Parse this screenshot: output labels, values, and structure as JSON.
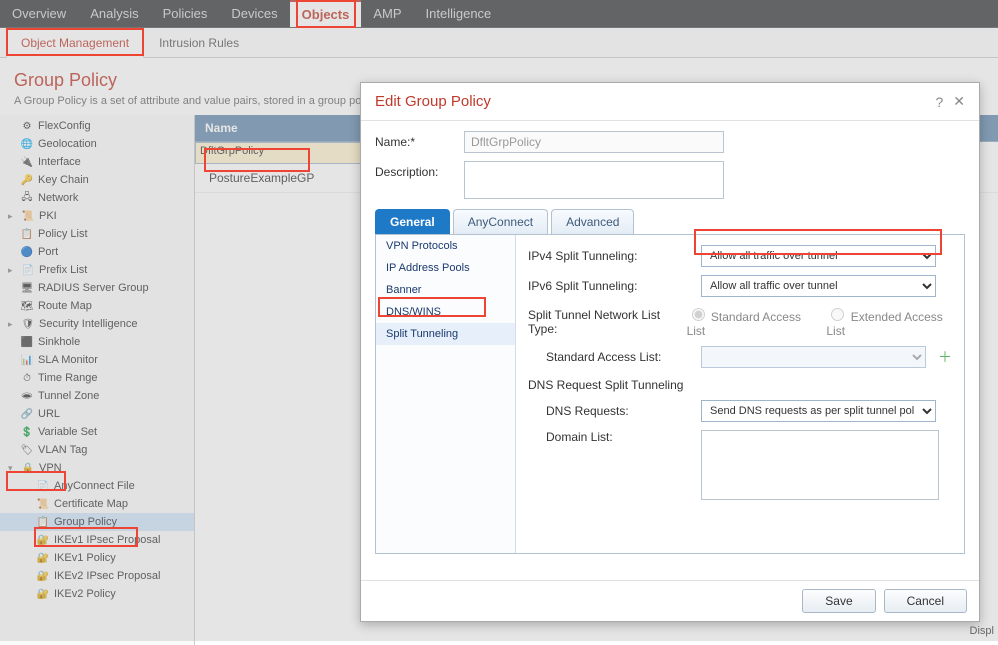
{
  "topnav": {
    "tabs": [
      "Overview",
      "Analysis",
      "Policies",
      "Devices",
      "Objects",
      "AMP",
      "Intelligence"
    ],
    "active": "Objects"
  },
  "subnav": {
    "tabs": [
      "Object Management",
      "Intrusion Rules"
    ],
    "active": "Object Management"
  },
  "page": {
    "title": "Group Policy",
    "desc": "A Group Policy is a set of attribute and value pairs, stored in a group policy object, that define the remote access VPN experience. The RADIUS authorization server assigns the group policy or"
  },
  "tree": [
    {
      "label": "FlexConfig",
      "icon": "⚙"
    },
    {
      "label": "Geolocation",
      "icon": "🌐"
    },
    {
      "label": "Interface",
      "icon": "🔌"
    },
    {
      "label": "Key Chain",
      "icon": "🔑"
    },
    {
      "label": "Network",
      "icon": "🖧"
    },
    {
      "label": "PKI",
      "icon": "📜",
      "caret": true
    },
    {
      "label": "Policy List",
      "icon": "📋"
    },
    {
      "label": "Port",
      "icon": "🔵"
    },
    {
      "label": "Prefix List",
      "icon": "📄",
      "caret": true
    },
    {
      "label": "RADIUS Server Group",
      "icon": "🖥"
    },
    {
      "label": "Route Map",
      "icon": "🗺"
    },
    {
      "label": "Security Intelligence",
      "icon": "🛡",
      "caret": true
    },
    {
      "label": "Sinkhole",
      "icon": "⬛"
    },
    {
      "label": "SLA Monitor",
      "icon": "📊"
    },
    {
      "label": "Time Range",
      "icon": "⏱"
    },
    {
      "label": "Tunnel Zone",
      "icon": "🕳"
    },
    {
      "label": "URL",
      "icon": "🔗"
    },
    {
      "label": "Variable Set",
      "icon": "💲"
    },
    {
      "label": "VLAN Tag",
      "icon": "🏷"
    },
    {
      "label": "VPN",
      "icon": "🔒",
      "caret": true,
      "open": true,
      "children": [
        {
          "label": "AnyConnect File",
          "icon": "📄"
        },
        {
          "label": "Certificate Map",
          "icon": "📜"
        },
        {
          "label": "Group Policy",
          "icon": "📋",
          "selected": true
        },
        {
          "label": "IKEv1 IPsec Proposal",
          "icon": "🔐"
        },
        {
          "label": "IKEv1 Policy",
          "icon": "🔐"
        },
        {
          "label": "IKEv2 IPsec Proposal",
          "icon": "🔐"
        },
        {
          "label": "IKEv2 Policy",
          "icon": "🔐"
        }
      ]
    }
  ],
  "list": {
    "header": "Name",
    "rows": [
      {
        "name": "DfltGrpPolicy",
        "selected": true
      },
      {
        "name": "PostureExampleGP"
      }
    ]
  },
  "modal": {
    "title": "Edit Group Policy",
    "name_label": "Name:*",
    "name_value": "DfltGrpPolicy",
    "desc_label": "Description:",
    "tabs": [
      "General",
      "AnyConnect",
      "Advanced"
    ],
    "active_tab": "General",
    "side_items": [
      "VPN Protocols",
      "IP Address Pools",
      "Banner",
      "DNS/WINS",
      "Split Tunneling"
    ],
    "side_active": "Split Tunneling",
    "settings": {
      "ipv4_label": "IPv4 Split Tunneling:",
      "ipv4_value": "Allow all traffic over tunnel",
      "ipv6_label": "IPv6 Split Tunneling:",
      "ipv6_value": "Allow all traffic over tunnel",
      "nlt_label": "Split Tunnel Network List Type:",
      "nlt_opt1": "Standard Access List",
      "nlt_opt2": "Extended Access List",
      "std_acl_label": "Standard Access List:",
      "dns_section": "DNS Request Split Tunneling",
      "dns_req_label": "DNS Requests:",
      "dns_req_value": "Send DNS requests as per split tunnel policy",
      "domain_label": "Domain List:"
    },
    "save": "Save",
    "cancel": "Cancel"
  },
  "footer_hint": "Displ"
}
